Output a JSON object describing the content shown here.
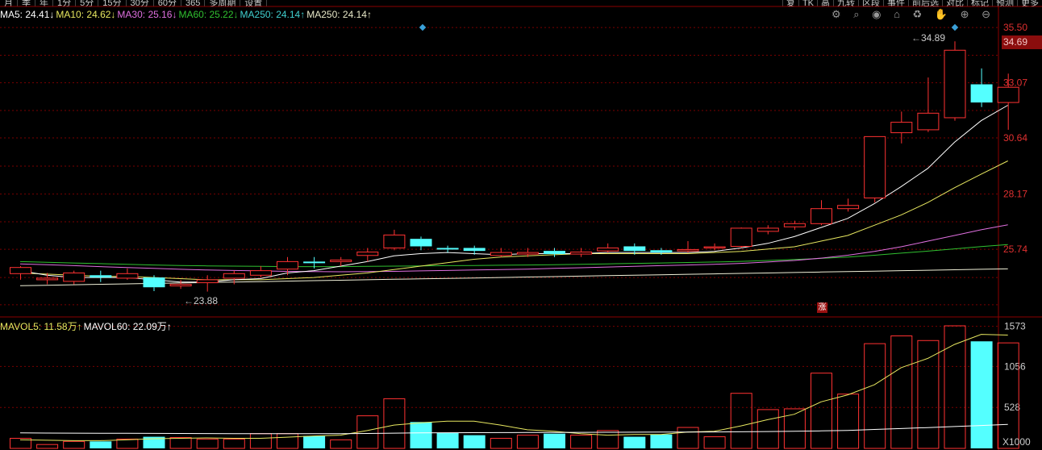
{
  "toolbar_left": [
    "月",
    "季",
    "年",
    "1分",
    "5分",
    "15分",
    "30分",
    "60分",
    "365",
    "多周期",
    "设置"
  ],
  "toolbar_right": [
    "复",
    "TK",
    "高",
    "九转",
    "区段",
    "事件",
    "前后选",
    "对比",
    "标记",
    "预测",
    "更多"
  ],
  "tool_icons": [
    "settings-icon",
    "zoom-icon",
    "eye-icon",
    "lock-icon",
    "trash-icon",
    "hand-icon",
    "plus-icon",
    "minus-icon"
  ],
  "tool_glyphs": "⚙ ⌕ ◉ ⌂ ♻ ✋ ⊕ ⊖",
  "ma_legend": [
    {
      "text": "MA5: 24.41↓",
      "color": "#ffffff"
    },
    {
      "text": "MA10: 24.62↓",
      "color": "#e8e860"
    },
    {
      "text": "MA30: 25.16↓",
      "color": "#e070e0"
    },
    {
      "text": "MA60: 25.22↓",
      "color": "#30c030"
    },
    {
      "text": "MA250: 24.14↑",
      "color": "#40d0d0"
    },
    {
      "text": "MA250: 24.14↑",
      "color": "#e8e8c8"
    }
  ],
  "vol_legend": [
    {
      "text": "MAVOL5: 11.58万↑",
      "color": "#e8e860"
    },
    {
      "text": "MAVOL60: 22.09万↑",
      "color": "#ffffff"
    }
  ],
  "current_price": "34.69",
  "price_high_label": "34.89",
  "price_low_label": "23.88",
  "zhang_badge": "涨",
  "volume_unit": "X1000",
  "colors": {
    "up": "#ff3232",
    "down": "#54ffff",
    "ma5": "#ffffff",
    "ma10": "#e8e860",
    "ma30": "#e070e0",
    "ma60": "#30c030",
    "ma250": "#f0f0d8",
    "grid": "#7a0000"
  },
  "chart_data": {
    "type": "candlestick",
    "price_axis": {
      "ticks": [
        "35.50",
        "33.07",
        "30.64",
        "28.17",
        "25.74"
      ],
      "range": [
        22.8,
        36.0
      ]
    },
    "volume_axis": {
      "ticks": [
        "1573",
        "1056",
        "528"
      ],
      "range": [
        0,
        1580
      ]
    },
    "candles": [
      {
        "open": 24.67,
        "close": 24.94,
        "high": 25.0,
        "low": 24.4,
        "volume": 130
      },
      {
        "open": 24.4,
        "close": 24.47,
        "high": 24.7,
        "low": 24.2,
        "volume": 50
      },
      {
        "open": 24.33,
        "close": 24.7,
        "high": 24.8,
        "low": 24.2,
        "volume": 90
      },
      {
        "open": 24.6,
        "close": 24.5,
        "high": 24.8,
        "low": 24.3,
        "volume": 90
      },
      {
        "open": 24.47,
        "close": 24.67,
        "high": 24.9,
        "low": 24.4,
        "volume": 120
      },
      {
        "open": 24.5,
        "close": 24.07,
        "high": 24.6,
        "low": 23.9,
        "volume": 150
      },
      {
        "open": 24.13,
        "close": 24.2,
        "high": 24.4,
        "low": 24.0,
        "volume": 140
      },
      {
        "open": 24.27,
        "close": 24.4,
        "high": 24.6,
        "low": 23.88,
        "volume": 120
      },
      {
        "open": 24.47,
        "close": 24.67,
        "high": 24.8,
        "low": 24.2,
        "volume": 120
      },
      {
        "open": 24.6,
        "close": 24.8,
        "high": 25.0,
        "low": 24.5,
        "volume": 190
      },
      {
        "open": 24.87,
        "close": 25.2,
        "high": 25.4,
        "low": 24.6,
        "volume": 190
      },
      {
        "open": 25.2,
        "close": 25.13,
        "high": 25.4,
        "low": 24.9,
        "volume": 160
      },
      {
        "open": 25.2,
        "close": 25.27,
        "high": 25.4,
        "low": 25.0,
        "volume": 110
      },
      {
        "open": 25.47,
        "close": 25.62,
        "high": 25.8,
        "low": 25.2,
        "volume": 420
      },
      {
        "open": 25.8,
        "close": 26.37,
        "high": 26.6,
        "low": 25.7,
        "volume": 640
      },
      {
        "open": 26.2,
        "close": 25.87,
        "high": 26.3,
        "low": 25.7,
        "volume": 340
      },
      {
        "open": 25.8,
        "close": 25.73,
        "high": 25.9,
        "low": 25.6,
        "volume": 200
      },
      {
        "open": 25.8,
        "close": 25.67,
        "high": 25.9,
        "low": 25.5,
        "volume": 170
      },
      {
        "open": 25.47,
        "close": 25.6,
        "high": 25.8,
        "low": 25.4,
        "volume": 130
      },
      {
        "open": 25.53,
        "close": 25.6,
        "high": 25.8,
        "low": 25.4,
        "volume": 170
      },
      {
        "open": 25.67,
        "close": 25.53,
        "high": 25.8,
        "low": 25.4,
        "volume": 190
      },
      {
        "open": 25.53,
        "close": 25.62,
        "high": 25.8,
        "low": 25.4,
        "volume": 170
      },
      {
        "open": 25.67,
        "close": 25.8,
        "high": 26.0,
        "low": 25.6,
        "volume": 230
      },
      {
        "open": 25.87,
        "close": 25.67,
        "high": 26.0,
        "low": 25.5,
        "volume": 150
      },
      {
        "open": 25.7,
        "close": 25.6,
        "high": 25.8,
        "low": 25.5,
        "volume": 180
      },
      {
        "open": 25.67,
        "close": 25.73,
        "high": 26.1,
        "low": 25.6,
        "volume": 270
      },
      {
        "open": 25.8,
        "close": 25.85,
        "high": 26.0,
        "low": 25.7,
        "volume": 150
      },
      {
        "open": 25.87,
        "close": 26.67,
        "high": 26.7,
        "low": 25.8,
        "volume": 710
      },
      {
        "open": 26.53,
        "close": 26.67,
        "high": 26.8,
        "low": 26.4,
        "volume": 500
      },
      {
        "open": 26.73,
        "close": 26.87,
        "high": 27.0,
        "low": 26.6,
        "volume": 510
      },
      {
        "open": 26.87,
        "close": 27.53,
        "high": 27.9,
        "low": 26.8,
        "volume": 970
      },
      {
        "open": 27.53,
        "close": 27.67,
        "high": 27.97,
        "low": 27.4,
        "volume": 700
      },
      {
        "open": 28.0,
        "close": 30.7,
        "high": 30.7,
        "low": 27.8,
        "volume": 1350
      },
      {
        "open": 30.87,
        "close": 31.33,
        "high": 31.8,
        "low": 30.4,
        "volume": 1450
      },
      {
        "open": 31.0,
        "close": 31.73,
        "high": 33.3,
        "low": 30.9,
        "volume": 1390
      },
      {
        "open": 31.53,
        "close": 34.5,
        "high": 34.89,
        "low": 31.4,
        "volume": 1580
      },
      {
        "open": 33.0,
        "close": 32.2,
        "high": 33.7,
        "low": 32.0,
        "volume": 1380
      },
      {
        "open": 32.2,
        "close": 32.87,
        "high": 33.47,
        "low": 31.0,
        "volume": 1360
      }
    ],
    "ma5": [
      24.8,
      24.6,
      24.5,
      24.5,
      24.5,
      24.4,
      24.3,
      24.3,
      24.4,
      24.45,
      24.7,
      24.8,
      25.0,
      25.2,
      25.45,
      25.55,
      25.6,
      25.55,
      25.5,
      25.55,
      25.55,
      25.55,
      25.6,
      25.6,
      25.6,
      25.6,
      25.65,
      25.8,
      26.0,
      26.3,
      26.7,
      27.1,
      27.75,
      28.5,
      29.3,
      30.45,
      31.4,
      32.08
    ],
    "ma10": [
      24.7,
      24.65,
      24.6,
      24.55,
      24.55,
      24.5,
      24.45,
      24.4,
      24.4,
      24.4,
      24.45,
      24.5,
      24.6,
      24.7,
      24.85,
      25.0,
      25.15,
      25.3,
      25.4,
      25.45,
      25.5,
      25.55,
      25.55,
      25.55,
      25.55,
      25.55,
      25.6,
      25.65,
      25.75,
      25.85,
      26.1,
      26.35,
      26.8,
      27.25,
      27.8,
      28.45,
      29.05,
      29.63
    ],
    "ma30": [
      25.1,
      25.06,
      25.02,
      24.98,
      24.94,
      24.9,
      24.86,
      24.83,
      24.81,
      24.79,
      24.77,
      24.76,
      24.75,
      24.76,
      24.77,
      24.79,
      24.81,
      24.83,
      24.85,
      24.87,
      24.9,
      24.93,
      24.96,
      24.99,
      25.02,
      25.05,
      25.08,
      25.12,
      25.18,
      25.25,
      25.35,
      25.48,
      25.65,
      25.85,
      26.1,
      26.35,
      26.6,
      26.82
    ],
    "ma60": [
      25.2,
      25.17,
      25.14,
      25.11,
      25.08,
      25.05,
      25.03,
      25.01,
      25.0,
      24.99,
      24.98,
      24.98,
      24.98,
      24.99,
      25.0,
      25.01,
      25.02,
      25.03,
      25.04,
      25.05,
      25.06,
      25.08,
      25.1,
      25.12,
      25.14,
      25.16,
      25.18,
      25.21,
      25.25,
      25.29,
      25.34,
      25.4,
      25.48,
      25.57,
      25.66,
      25.76,
      25.86,
      25.95
    ],
    "ma250": [
      24.14,
      24.16,
      24.18,
      24.2,
      24.22,
      24.24,
      24.26,
      24.28,
      24.3,
      24.32,
      24.34,
      24.36,
      24.38,
      24.4,
      24.42,
      24.44,
      24.46,
      24.48,
      24.5,
      24.52,
      24.54,
      24.56,
      24.58,
      24.6,
      24.62,
      24.64,
      24.66,
      24.68,
      24.7,
      24.72,
      24.74,
      24.76,
      24.78,
      24.8,
      24.82,
      24.84,
      24.86,
      24.88
    ],
    "mavol5": [
      110,
      105,
      100,
      100,
      110,
      125,
      130,
      135,
      130,
      130,
      145,
      160,
      170,
      230,
      300,
      330,
      350,
      350,
      300,
      240,
      220,
      190,
      170,
      180,
      180,
      210,
      220,
      290,
      370,
      440,
      600,
      690,
      820,
      1040,
      1160,
      1340,
      1470,
      1460
    ],
    "mavol60": [
      200,
      198,
      196,
      195,
      194,
      193,
      192,
      191,
      190,
      190,
      190,
      190,
      190,
      192,
      196,
      200,
      202,
      203,
      204,
      205,
      206,
      207,
      208,
      209,
      210,
      211,
      212,
      214,
      217,
      220,
      226,
      232,
      244,
      256,
      268,
      282,
      295,
      310
    ]
  }
}
